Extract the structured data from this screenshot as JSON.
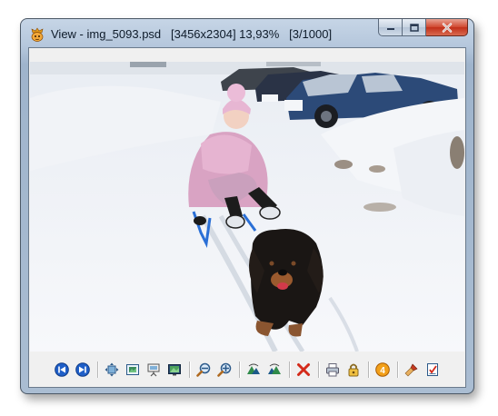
{
  "window": {
    "title": "View - img_5093.psd   [3456x2304] 13,93%   [3/1000]"
  },
  "colors": {
    "nav_blue": "#1f5fc8",
    "delete_red": "#d42a1a",
    "title_text": "#0e1b2a",
    "close_button": "#c2301a"
  },
  "photo": {
    "icon": "image-preview"
  },
  "toolbar": {
    "buttons": [
      {
        "name": "previous-image-button",
        "icon": "skip-back-icon"
      },
      {
        "name": "next-image-button",
        "icon": "skip-forward-icon"
      },
      {
        "name": "fit-to-window-button",
        "icon": "fit-window-icon"
      },
      {
        "name": "actual-size-button",
        "icon": "actual-size-icon"
      },
      {
        "name": "slideshow-button",
        "icon": "presentation-icon"
      },
      {
        "name": "fullscreen-button",
        "icon": "fullscreen-icon"
      },
      {
        "name": "zoom-out-button",
        "icon": "zoom-out-icon"
      },
      {
        "name": "zoom-in-button",
        "icon": "zoom-in-icon"
      },
      {
        "name": "rotate-left-button",
        "icon": "rotate-left-icon"
      },
      {
        "name": "rotate-right-button",
        "icon": "rotate-right-icon"
      },
      {
        "name": "delete-button",
        "icon": "delete-x-icon"
      },
      {
        "name": "print-button",
        "icon": "printer-icon"
      },
      {
        "name": "lock-button",
        "icon": "lock-icon"
      },
      {
        "name": "rating-button",
        "icon": "badge-4-icon",
        "label": "4"
      },
      {
        "name": "edit-button",
        "icon": "brush-icon"
      },
      {
        "name": "properties-button",
        "icon": "checklist-icon"
      }
    ]
  }
}
